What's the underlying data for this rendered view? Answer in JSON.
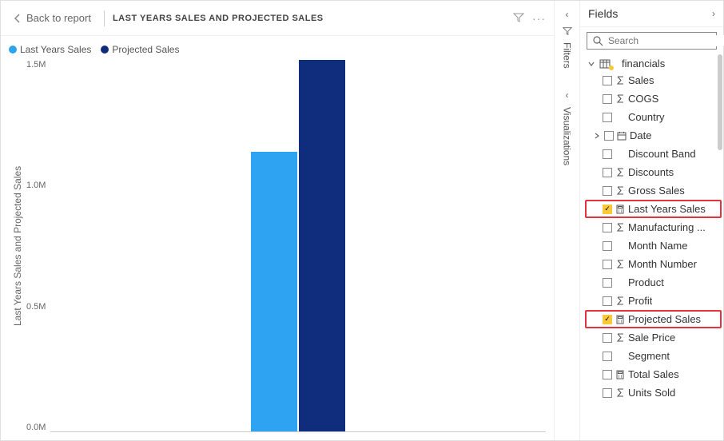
{
  "header": {
    "back_label": "Back to report",
    "chart_title": "LAST YEARS SALES AND PROJECTED SALES"
  },
  "legend": [
    {
      "label": "Last Years Sales",
      "color": "#2ea3f2"
    },
    {
      "label": "Projected Sales",
      "color": "#102c7c"
    }
  ],
  "yaxis_title": "Last Years Sales and Projected Sales",
  "chart_data": {
    "type": "bar",
    "title": "Last Years Sales and Projected Sales",
    "ylabel": "Last Years Sales and Projected Sales",
    "xlabel": "",
    "ylim": [
      0,
      1500000
    ],
    "yticks": [
      "0.0M",
      "0.5M",
      "1.0M",
      "1.5M"
    ],
    "categories": [
      ""
    ],
    "series": [
      {
        "name": "Last Years Sales",
        "color": "#2ea3f2",
        "values": [
          1130000
        ]
      },
      {
        "name": "Projected Sales",
        "color": "#102c7c",
        "values": [
          1500000
        ]
      }
    ]
  },
  "collapsed_panels": {
    "filters": "Filters",
    "visualizations": "Visualizations"
  },
  "fields": {
    "title": "Fields",
    "search_placeholder": "Search",
    "table": "financials",
    "items": [
      {
        "name": "Sales",
        "icon": "sum",
        "checked": false,
        "highlighted": false
      },
      {
        "name": "COGS",
        "icon": "sum",
        "checked": false,
        "highlighted": false
      },
      {
        "name": "Country",
        "icon": "",
        "checked": false,
        "highlighted": false
      },
      {
        "name": "Date",
        "icon": "date",
        "checked": false,
        "highlighted": false,
        "expandable": true
      },
      {
        "name": "Discount Band",
        "icon": "",
        "checked": false,
        "highlighted": false
      },
      {
        "name": "Discounts",
        "icon": "sum",
        "checked": false,
        "highlighted": false
      },
      {
        "name": "Gross Sales",
        "icon": "sum",
        "checked": false,
        "highlighted": false
      },
      {
        "name": "Last Years Sales",
        "icon": "calc",
        "checked": true,
        "highlighted": true
      },
      {
        "name": "Manufacturing ...",
        "icon": "sum",
        "checked": false,
        "highlighted": false
      },
      {
        "name": "Month Name",
        "icon": "",
        "checked": false,
        "highlighted": false
      },
      {
        "name": "Month Number",
        "icon": "sum",
        "checked": false,
        "highlighted": false
      },
      {
        "name": "Product",
        "icon": "",
        "checked": false,
        "highlighted": false
      },
      {
        "name": "Profit",
        "icon": "sum",
        "checked": false,
        "highlighted": false
      },
      {
        "name": "Projected Sales",
        "icon": "calc",
        "checked": true,
        "highlighted": true
      },
      {
        "name": "Sale Price",
        "icon": "sum",
        "checked": false,
        "highlighted": false
      },
      {
        "name": "Segment",
        "icon": "",
        "checked": false,
        "highlighted": false
      },
      {
        "name": "Total Sales",
        "icon": "calc",
        "checked": false,
        "highlighted": false
      },
      {
        "name": "Units Sold",
        "icon": "sum",
        "checked": false,
        "highlighted": false
      }
    ]
  }
}
